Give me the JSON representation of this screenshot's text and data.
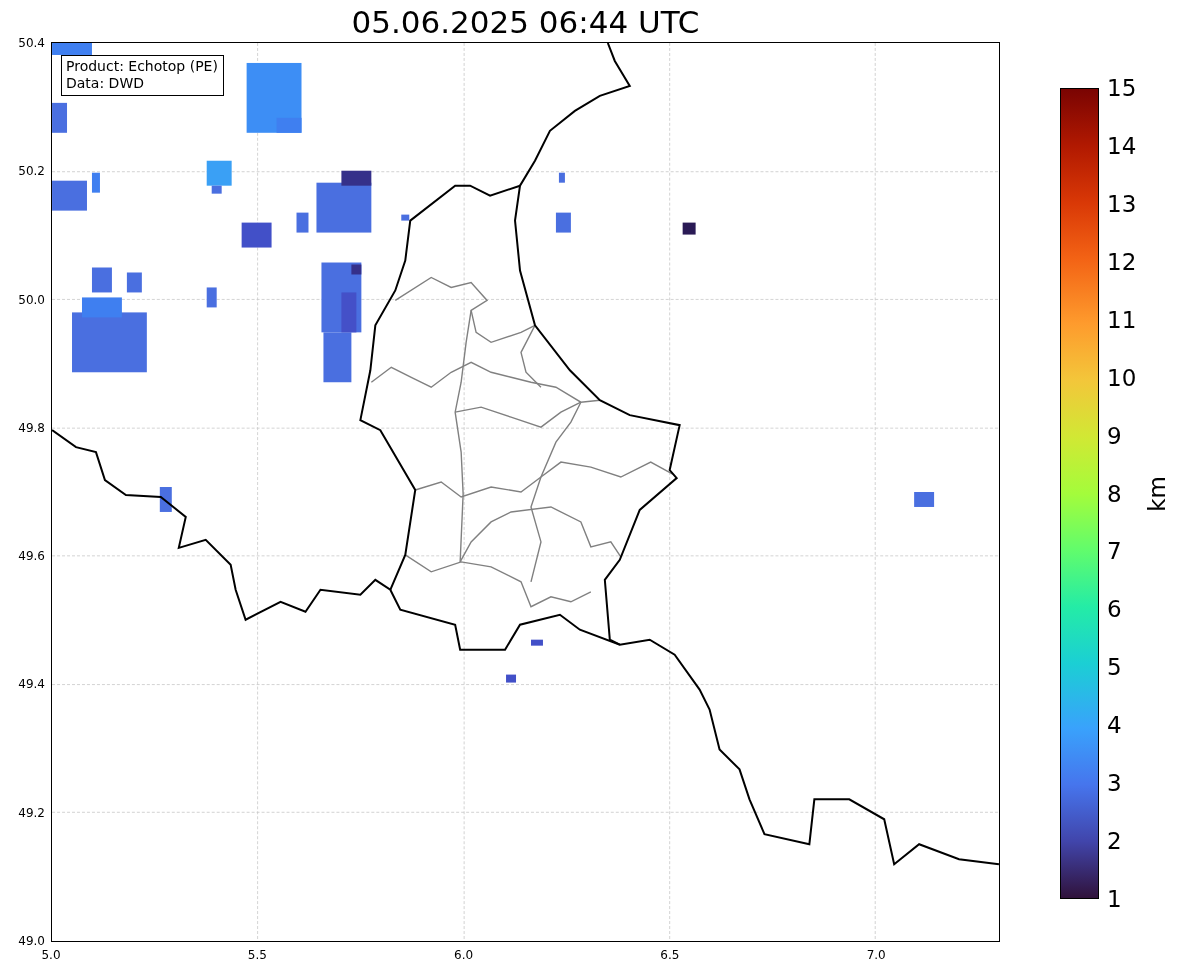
{
  "title": "05.06.2025 06:44 UTC",
  "legend": [
    "Product: Echotop (PE)",
    "Data: DWD"
  ],
  "map": {
    "x_tick_labels": [
      "5.0",
      "5.5",
      "6.0",
      "6.5",
      "7.0"
    ],
    "y_tick_labels": [
      "50.4",
      "50.2",
      "50.0",
      "49.8",
      "49.6",
      "49.4",
      "49.2",
      "49.0"
    ]
  },
  "colorbar": {
    "label": "km",
    "tick_labels": [
      "15",
      "14",
      "13",
      "12",
      "11",
      "10",
      "9",
      "8",
      "7",
      "6",
      "5",
      "4",
      "3",
      "2",
      "1"
    ]
  }
}
